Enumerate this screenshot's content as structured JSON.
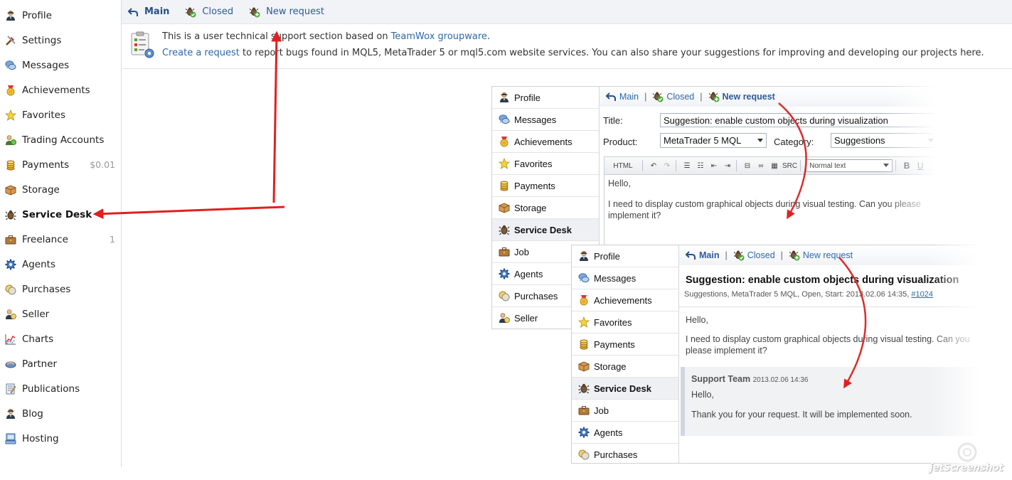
{
  "colors": {
    "link": "#2d6aa8",
    "toolbar_bg": "#f1f3f7",
    "arrow": "#e02020"
  },
  "sidebar": {
    "items": [
      {
        "label": "Profile",
        "icon": "user-icon",
        "badge": ""
      },
      {
        "label": "Settings",
        "icon": "tools-icon",
        "badge": ""
      },
      {
        "label": "Messages",
        "icon": "chat-bubbles-icon",
        "badge": ""
      },
      {
        "label": "Achievements",
        "icon": "medal-icon",
        "badge": ""
      },
      {
        "label": "Favorites",
        "icon": "star-icon",
        "badge": ""
      },
      {
        "label": "Trading Accounts",
        "icon": "money-user-icon",
        "badge": ""
      },
      {
        "label": "Payments",
        "icon": "coins-icon",
        "badge": "$0.01"
      },
      {
        "label": "Storage",
        "icon": "box-icon",
        "badge": ""
      },
      {
        "label": "Service Desk",
        "icon": "bug-icon",
        "badge": "",
        "active": true
      },
      {
        "label": "Freelance",
        "icon": "briefcase-icon",
        "badge": "1"
      },
      {
        "label": "Agents",
        "icon": "gear-icon",
        "badge": ""
      },
      {
        "label": "Purchases",
        "icon": "coins-stack-icon",
        "badge": ""
      },
      {
        "label": "Seller",
        "icon": "seller-icon",
        "badge": ""
      },
      {
        "label": "Charts",
        "icon": "chart-icon",
        "badge": ""
      },
      {
        "label": "Partner",
        "icon": "handshake-icon",
        "badge": ""
      },
      {
        "label": "Publications",
        "icon": "publication-icon",
        "badge": ""
      },
      {
        "label": "Blog",
        "icon": "user-icon",
        "badge": ""
      },
      {
        "label": "Hosting",
        "icon": "server-icon",
        "badge": ""
      }
    ]
  },
  "toolbar": {
    "main": "Main",
    "closed": "Closed",
    "new_request": "New request"
  },
  "info": {
    "line1_prefix": "This is a user technical support section based on ",
    "line1_link": "TeamWox groupware",
    "line1_suffix": ".",
    "line2_link": "Create a request",
    "line2_rest": " to report bugs found in MQL5, MetaTrader 5 or mql5.com website services. You can also share your suggestions for improving and developing our projects here."
  },
  "panel1": {
    "sidebar": [
      "Profile",
      "Messages",
      "Achievements",
      "Favorites",
      "Payments",
      "Storage",
      "Service Desk",
      "Job",
      "Agents",
      "Purchases",
      "Seller"
    ],
    "sidebar_icons": [
      "user-icon",
      "chat-bubbles-icon",
      "medal-icon",
      "star-icon",
      "coins-icon",
      "box-icon",
      "bug-icon",
      "briefcase-icon",
      "gear-icon",
      "coins-stack-icon",
      "seller-icon"
    ],
    "active": "Service Desk",
    "toolbar": {
      "main": "Main",
      "closed": "Closed",
      "new_request": "New request"
    },
    "form": {
      "title_label": "Title:",
      "title_value": "Suggestion: enable custom objects during visualization",
      "product_label": "Product:",
      "product_value": "MetaTrader 5 MQL",
      "category_label": "Category:",
      "category_value": "Suggestions",
      "editor_html": "HTML",
      "editor_src": "SRC",
      "editor_format": "Normal text",
      "editor_bold": "B",
      "editor_underline": "U",
      "body_line1": "Hello,",
      "body_line2": "I need to display custom graphical objects during visual testing. Can you please implement it?"
    }
  },
  "panel2": {
    "sidebar": [
      "Profile",
      "Messages",
      "Achievements",
      "Favorites",
      "Payments",
      "Storage",
      "Service Desk",
      "Job",
      "Agents",
      "Purchases"
    ],
    "sidebar_icons": [
      "user-icon",
      "chat-bubbles-icon",
      "medal-icon",
      "star-icon",
      "coins-icon",
      "box-icon",
      "bug-icon",
      "briefcase-icon",
      "gear-icon",
      "coins-stack-icon"
    ],
    "active": "Service Desk",
    "toolbar": {
      "main": "Main",
      "closed": "Closed",
      "new_request": "New request"
    },
    "ticket": {
      "title": "Suggestion: enable custom objects during visualization",
      "meta": "Suggestions, MetaTrader 5 MQL, Open, Start: 2013.02.06 14:35, ",
      "meta_link": "#1024",
      "body_line1": "Hello,",
      "body_line2": "I need to display custom graphical objects during visual testing. Can you please implement it?",
      "reply_author": "Support Team",
      "reply_date": "2013.02.06 14:36",
      "reply_line1": "Hello,",
      "reply_line2": "Thank you for your request. It will be implemented soon."
    }
  },
  "watermark": {
    "text": "jetScreenshot"
  }
}
